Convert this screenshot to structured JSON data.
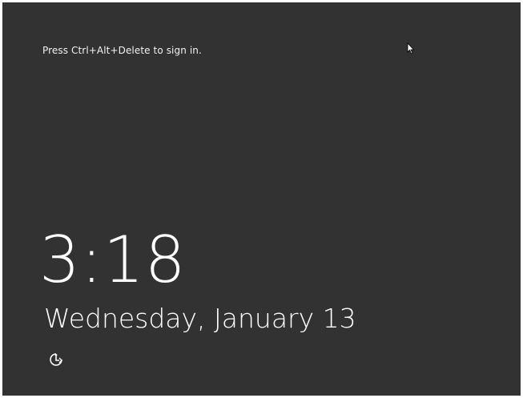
{
  "lock_screen": {
    "prompt": "Press Ctrl+Alt+Delete to sign in.",
    "time": "3:18",
    "date": "Wednesday, January 13",
    "ease_of_access_icon": "ease-of-access-icon",
    "background_color": "#323232",
    "text_color": "#ffffff"
  }
}
